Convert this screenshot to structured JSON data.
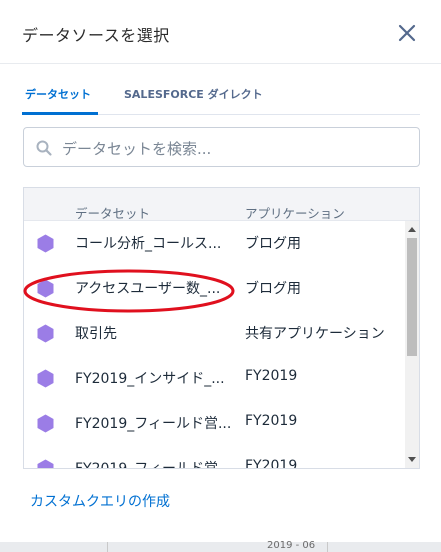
{
  "modal": {
    "title": "データソースを選択",
    "close_icon": "close-icon"
  },
  "tabs": [
    {
      "label": "データセット",
      "active": true
    },
    {
      "label": "SALESFORCE ダイレクト",
      "active": false
    }
  ],
  "search": {
    "placeholder": "データセットを検索...",
    "icon": "search-icon"
  },
  "table": {
    "headers": [
      "データセット",
      "アプリケーション"
    ],
    "rows": [
      {
        "icon": "dataset-icon",
        "name": "コール分析_コールス...",
        "app": "ブログ用"
      },
      {
        "icon": "dataset-icon",
        "name": "アクセスユーザー数_...",
        "app": "ブログ用"
      },
      {
        "icon": "dataset-icon",
        "name": "取引先",
        "app": "共有アプリケーション"
      },
      {
        "icon": "dataset-icon",
        "name": "FY2019_インサイド_...",
        "app": "FY2019"
      },
      {
        "icon": "dataset-icon",
        "name": "FY2019_フィールド営...",
        "app": "FY2019"
      },
      {
        "icon": "dataset-icon",
        "name": "FY2019_フィールド営...",
        "app": "FY2019"
      }
    ]
  },
  "footer": {
    "custom_query_link": "カスタムクエリの作成"
  },
  "background": {
    "partial_text": "2019 - 06"
  },
  "colors": {
    "accent": "#0070d2",
    "dataset_icon": "#9b7de6",
    "annotation": "#e0101e"
  }
}
